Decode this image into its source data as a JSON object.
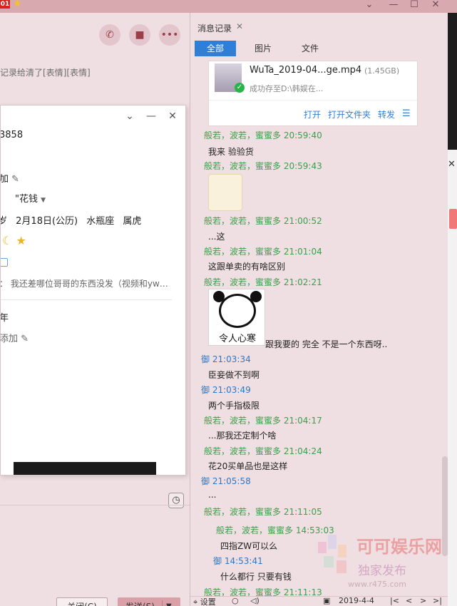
{
  "titlebar": {
    "badge": "01"
  },
  "left": {
    "history_text": "记录给清了[表情][表情]",
    "card": {
      "number": "3858",
      "add1": "加",
      "dropdown": "\"花钱",
      "birthday": "2月18日(公历)",
      "zodiac": "水瓶座",
      "chinese_zodiac": "属虎",
      "sign_prefix": "：",
      "signature": "我还差哪位哥哥的东西没发（视频和yw…",
      "year": "年",
      "add2": "添加",
      "glyph_left": "岁"
    },
    "close_button": "关闭(C)",
    "send_button": "发送(S)"
  },
  "right": {
    "tab_label": "消息记录",
    "subtabs": [
      "全部",
      "图片",
      "文件"
    ],
    "file": {
      "name": "WuTa_2019-04...ge.mp4",
      "size": "(1.45GB)",
      "status": "成功存至D:\\韩娱在...",
      "actions": [
        "打开",
        "打开文件夹",
        "转发"
      ]
    },
    "messages": [
      {
        "head": "般若，波若，蜜蜜多 20:59:40",
        "body": "我来 验验货"
      },
      {
        "head": "般若，波若，蜜蜜多 20:59:43",
        "body": ""
      },
      {
        "head": "般若，波若，蜜蜜多 21:00:52",
        "body": "...这"
      },
      {
        "head": "般若，波若，蜜蜜多 21:01:04",
        "body": "这跟单卖的有啥区别"
      },
      {
        "head": "般若，波若，蜜蜜多 21:02:21",
        "body": "跟我要的 完全 不是一个东西呀.."
      },
      {
        "head": "御 21:03:34",
        "body": "臣妾做不到啊"
      },
      {
        "head": "御 21:03:49",
        "body": "两个手指极限"
      },
      {
        "head": "般若，波若，蜜蜜多 21:04:17",
        "body": "...那我还定制个啥"
      },
      {
        "head": "般若，波若，蜜蜜多 21:04:24",
        "body": "花20买单品也是这样"
      },
      {
        "head": "御 21:05:58",
        "body": "..."
      },
      {
        "head": "般若，波若，蜜蜜多 21:11:05",
        "body": ""
      },
      {
        "head": "般若，波若，蜜蜜多 14:53:03",
        "body": "四指ZW可以么"
      },
      {
        "head": "御 14:53:41",
        "body": "什么都行 只要有钱"
      },
      {
        "head": "般若，波若，蜜蜜多 21:11:13",
        "body": ""
      }
    ],
    "sticker_caption": "令人心寒",
    "footer": {
      "settings": "设置",
      "date": "2019-4-4"
    }
  },
  "watermark": {
    "title": "可可娱乐网",
    "subtitle": "独家发布",
    "url": "www.r475.com"
  }
}
